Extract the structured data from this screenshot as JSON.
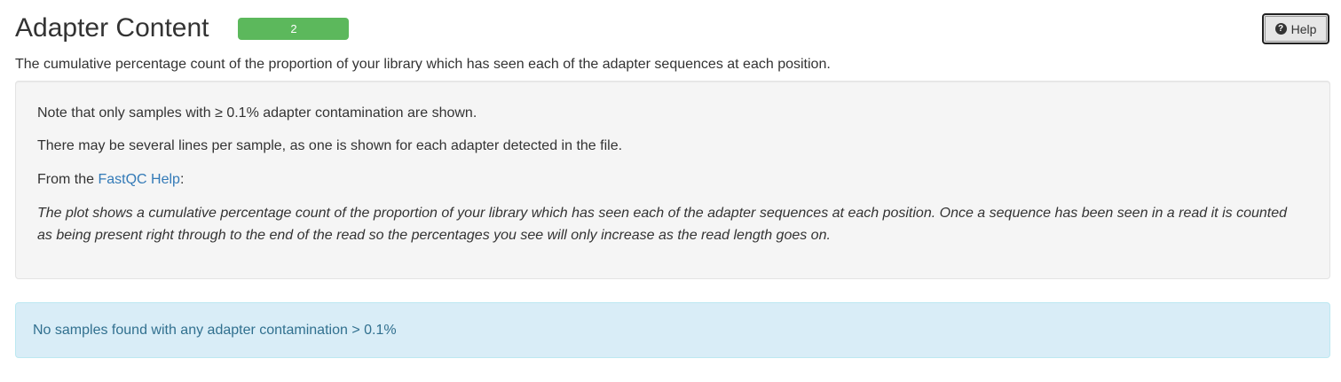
{
  "section": {
    "title": "Adapter Content",
    "status_badge": "2",
    "status_color": "#5cb85c",
    "help_button": {
      "icon": "question-circle-icon",
      "label": "Help"
    },
    "description": "The cumulative percentage count of the proportion of your library which has seen each of the adapter sequences at each position."
  },
  "info_box": {
    "note_1": "Note that only samples with ≥ 0.1% adapter contamination are shown.",
    "note_2": "There may be several lines per sample, as one is shown for each adapter detected in the file.",
    "from_prefix": "From the ",
    "link_text": "FastQC Help",
    "from_suffix": ":",
    "quote": "The plot shows a cumulative percentage count of the proportion of your library which has seen each of the adapter sequences at each position. Once a sequence has been seen in a read it is counted as being present right through to the end of the read so the percentages you see will only increase as the read length goes on."
  },
  "alert": {
    "message": "No samples found with any adapter contamination > 0.1%"
  }
}
